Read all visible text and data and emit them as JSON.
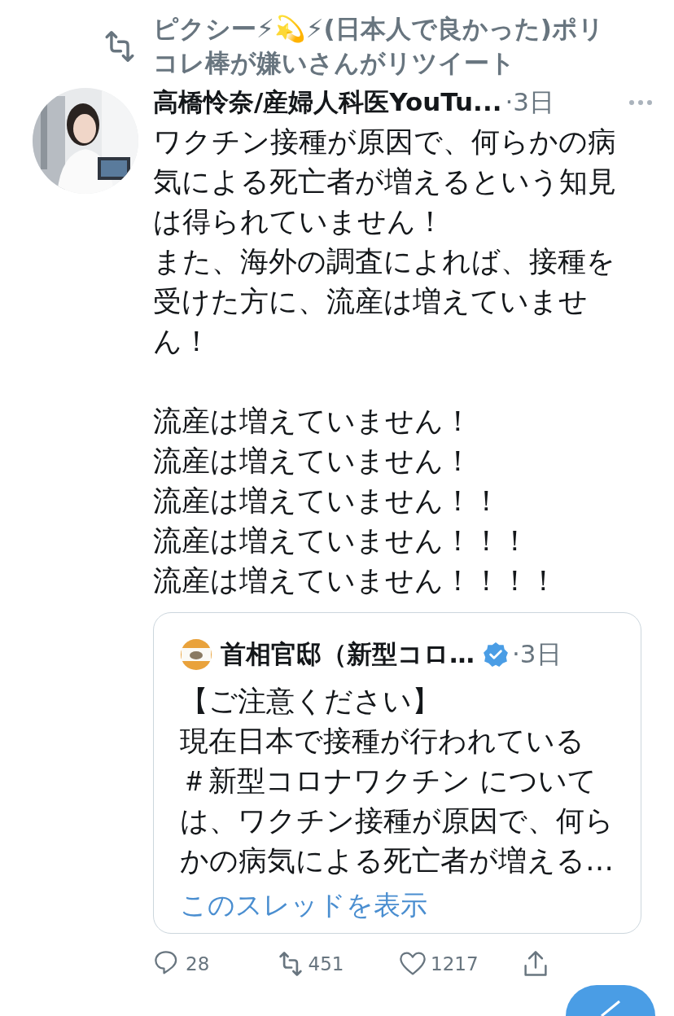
{
  "retweet_banner": {
    "text": "ピクシー⚡💫⚡(日本人で良かった)ポリコレ棒が嫌いさんがリツイート"
  },
  "tweet": {
    "author": "高橋怜奈/産婦人科医YouTu...",
    "time": "·3日",
    "avatar": {
      "kind": "picture"
    },
    "body": [
      "ワクチン接種が原因で、何らかの病気による死亡者が増えるという知見は得られていません！",
      "また、海外の調査によれば、接種を受けた方に、流産は増えていません！"
    ],
    "emphasis": [
      "流産は増えていません！",
      "流産は増えていません！",
      "流産は増えていません！！",
      "流産は増えていません！！！",
      "流産は増えていません！！！！"
    ],
    "quote": {
      "author": "首相官邸（新型コロ…",
      "verified": true,
      "time": "·3日",
      "body": [
        "【ご注意ください】",
        "現在日本で接種が行われている",
        "＃新型コロナワクチン については、ワクチン接種が原因で、何らかの病気による死亡者が増える…"
      ],
      "link": "このスレッドを表示"
    },
    "actions": [
      {
        "kind": "reply",
        "count": "28"
      },
      {
        "kind": "retweet",
        "count": "451"
      },
      {
        "kind": "like",
        "count": "1217"
      },
      {
        "kind": "share"
      }
    ]
  }
}
